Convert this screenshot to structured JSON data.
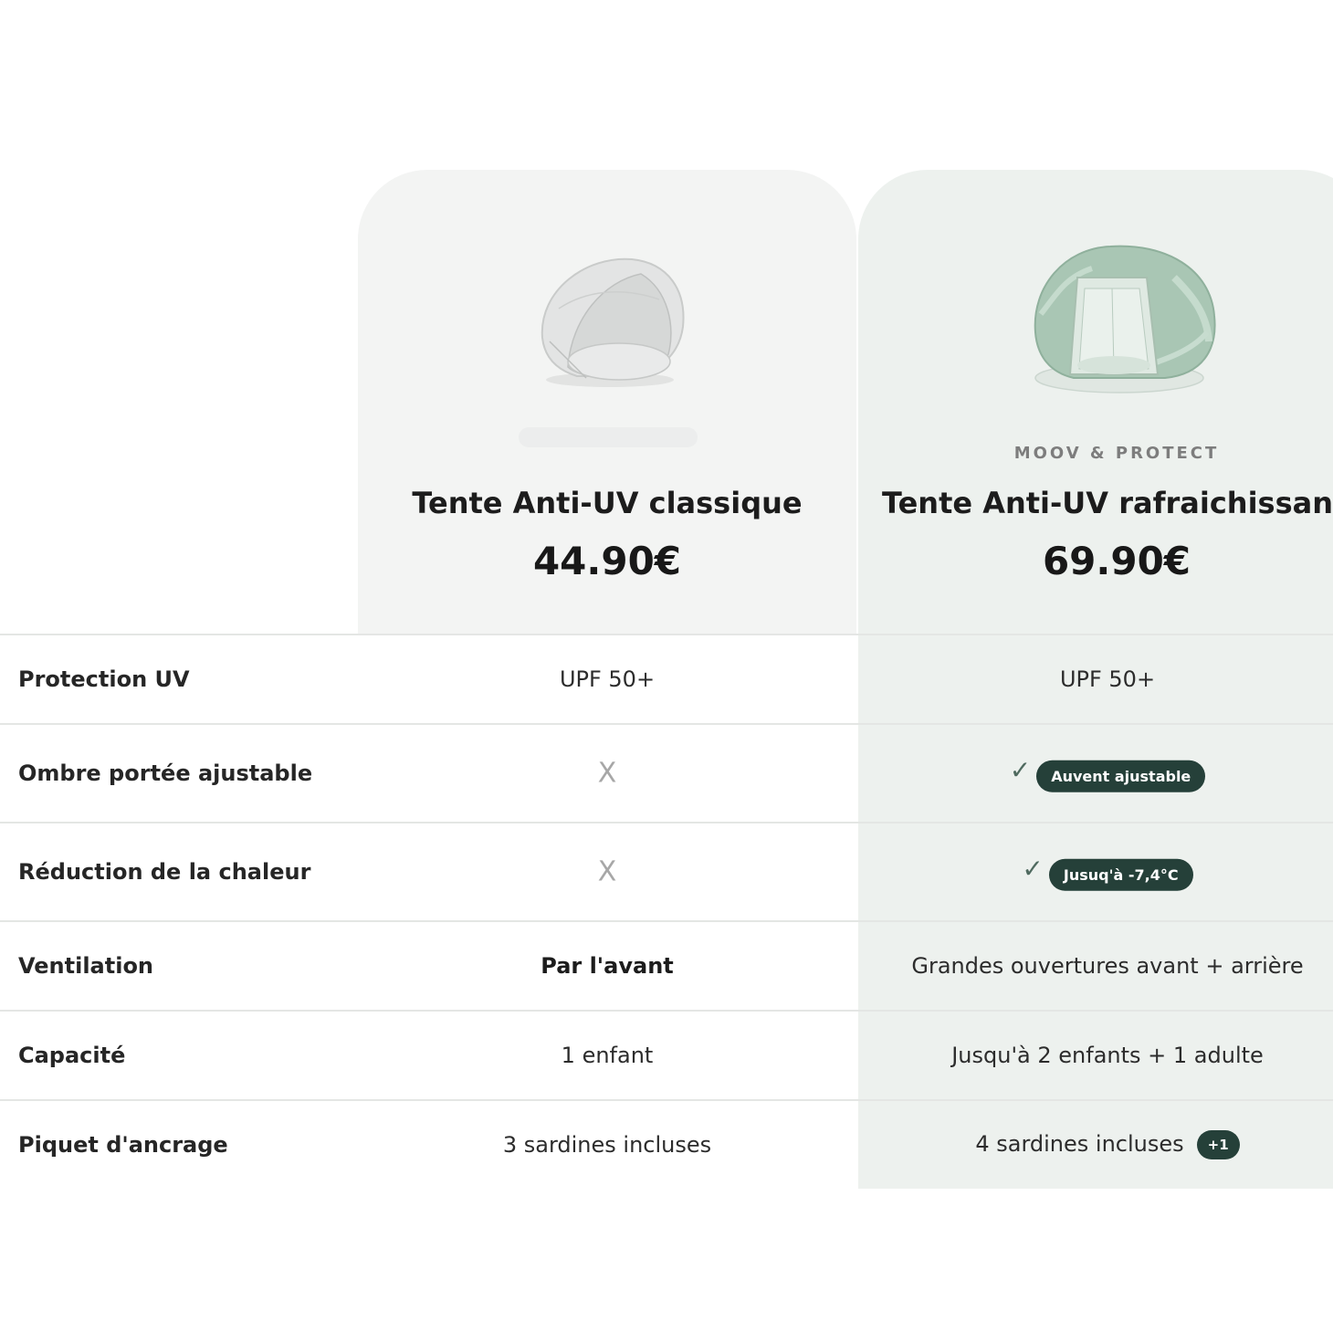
{
  "products": [
    {
      "brand": "",
      "name": "Tente Anti-UV classique",
      "price": "44.90€",
      "image_icon": "tent-white-icon"
    },
    {
      "brand": "MOOV & PROTECT",
      "name": "Tente Anti-UV rafraichissant",
      "price": "69.90€",
      "image_icon": "tent-green-icon"
    }
  ],
  "rows": [
    {
      "label": "Protection UV",
      "p1": "UPF 50+",
      "p2": "UPF 50+"
    },
    {
      "label": "Ombre portée ajustable",
      "p1_icon": "cross-icon",
      "p1": "X",
      "p2_icon": "check-icon",
      "p2_check": "✓",
      "p2_badge": "Auvent ajustable"
    },
    {
      "label": "Réduction de la chaleur",
      "p1_icon": "cross-icon",
      "p1": "X",
      "p2_icon": "check-icon",
      "p2_check": "✓",
      "p2_badge": "Jusuq'à -7,4°C"
    },
    {
      "label": "Ventilation",
      "p1": "Par l'avant",
      "p2": "Grandes ouvertures avant + arrière"
    },
    {
      "label": "Capacité",
      "p1": "1 enfant",
      "p2": "Jusqu'à 2 enfants + 1 adulte"
    },
    {
      "label": "Piquet d'ancrage",
      "p1": "3 sardines incluses",
      "p2": "4 sardines incluses",
      "p2_badge": "+1"
    }
  ],
  "colors": {
    "card_1_bg": "#f3f4f3",
    "card_2_bg": "#edf1ee",
    "badge_bg": "#254039",
    "check": "#4f6a5f",
    "cross": "#a7a7a7"
  }
}
